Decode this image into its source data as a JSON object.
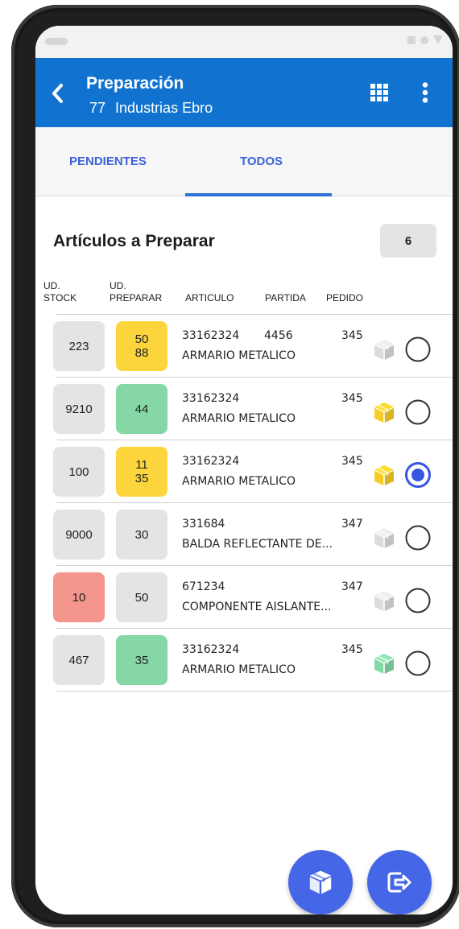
{
  "appbar": {
    "title": "Preparación",
    "subtitle_number": "77",
    "subtitle_name": "Industrias Ebro",
    "color": "#1173cf"
  },
  "tabs": [
    {
      "label": "PENDIENTES",
      "active": false
    },
    {
      "label": "TODOS",
      "active": true
    }
  ],
  "section": {
    "title": "Artículos a Preparar",
    "count": "6"
  },
  "columns": {
    "stock_line1": "UD.",
    "stock_line2": "STOCK",
    "prep_line1": "UD.",
    "prep_line2": "PREPARAR",
    "articulo": "ARTICULO",
    "partida": "PARTIDA",
    "pedido": "PEDIDO"
  },
  "rows": [
    {
      "stock": "223",
      "stock_color": "#e4e4e4",
      "prep_line1": "50",
      "prep_line2": "88",
      "prep_color": "#fcd43c",
      "articulo": "33162324",
      "partida": "4456",
      "pedido": "345",
      "description": "ARMARIO METALICO",
      "package_icon": "package-icon",
      "package_color": "#dcdcdc",
      "selected": false
    },
    {
      "stock": "9210",
      "stock_color": "#e4e4e4",
      "prep_line1": "44",
      "prep_line2": "",
      "prep_color": "#85d8a5",
      "articulo": "33162324",
      "partida": "",
      "pedido": "345",
      "description": "ARMARIO METALICO",
      "package_icon": "package-icon",
      "package_color": "#f7cc27",
      "selected": false
    },
    {
      "stock": "100",
      "stock_color": "#e4e4e4",
      "prep_line1": "11",
      "prep_line2": "35",
      "prep_color": "#fcd43c",
      "articulo": "33162324",
      "partida": "",
      "pedido": "345",
      "description": "ARMARIO METALICO",
      "package_icon": "package-icon",
      "package_color": "#f7cc27",
      "selected": true
    },
    {
      "stock": "9000",
      "stock_color": "#e4e4e4",
      "prep_line1": "30",
      "prep_line2": "",
      "prep_color": "#e4e4e4",
      "articulo": "331684",
      "partida": "",
      "pedido": "347",
      "description": "BALDA REFLECTANTE DE...",
      "package_icon": "package-icon",
      "package_color": "#dcdcdc",
      "selected": false
    },
    {
      "stock": "10",
      "stock_color": "#f4968e",
      "prep_line1": "50",
      "prep_line2": "",
      "prep_color": "#e4e4e4",
      "articulo": "671234",
      "partida": "",
      "pedido": "347",
      "description": "COMPONENTE AISLANTE...",
      "package_icon": "package-icon",
      "package_color": "#dcdcdc",
      "selected": false
    },
    {
      "stock": "467",
      "stock_color": "#e4e4e4",
      "prep_line1": "35",
      "prep_line2": "",
      "prep_color": "#85d8a5",
      "articulo": "33162324",
      "partida": "",
      "pedido": "345",
      "description": "ARMARIO METALICO",
      "package_icon": "package-icon",
      "package_color": "#85d8a5",
      "selected": false
    }
  ],
  "fabs": {
    "pack_icon": "package-icon",
    "exit_icon": "exit-icon",
    "color": "#4566e6"
  }
}
